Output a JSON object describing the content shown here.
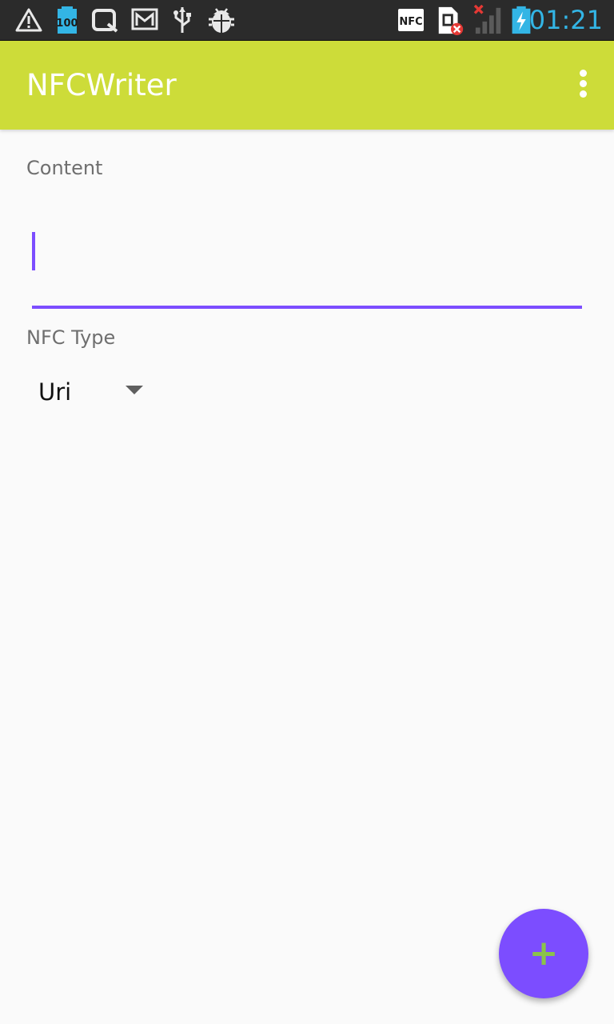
{
  "status_bar": {
    "time": "01:21",
    "nfc_badge": "NFC",
    "battery_level_badge": "100",
    "time_color": "#33b5e5",
    "icons": [
      "warning-icon",
      "battery-100-icon",
      "search-notification-icon",
      "gmail-icon",
      "usb-icon",
      "debug-bug-icon",
      "nfc-icon",
      "sim-error-icon",
      "signal-no-service-icon",
      "battery-charging-icon"
    ]
  },
  "app_bar": {
    "title": "NFCWriter",
    "color": "#cddc39",
    "overflow_icon": "more-vert-icon"
  },
  "form": {
    "content_label": "Content",
    "content_value": "",
    "type_label": "NFC Type",
    "type_selected": "Uri",
    "accent_color": "#7c4dff"
  },
  "fab": {
    "icon": "plus-icon",
    "label": "+",
    "color": "#7c4dff",
    "icon_color": "#8bc34a"
  }
}
